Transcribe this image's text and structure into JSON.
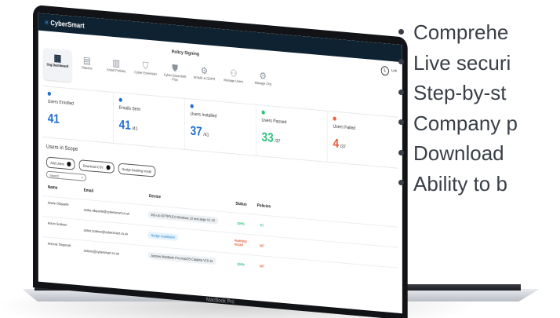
{
  "app": {
    "brand": "CyberSmart",
    "page_title": "Policy Signing",
    "user_label": "Lee",
    "user_initial": "L"
  },
  "nav": [
    {
      "label": "Org Dashboard",
      "icon": "grid-icon",
      "glyph": "▦"
    },
    {
      "label": "Reports",
      "icon": "document-icon",
      "glyph": "▤"
    },
    {
      "label": "Smart Policies",
      "icon": "policy-icon",
      "glyph": "▥"
    },
    {
      "label": "Cyber Essentials",
      "icon": "shield-icon",
      "glyph": "⛉"
    },
    {
      "label": "Cyber Essentials Plus",
      "icon": "shield-plus-icon",
      "glyph": "⛊"
    },
    {
      "label": "IASME & GDPR",
      "icon": "gear-icon",
      "glyph": "⚙"
    },
    {
      "label": "Manage Users",
      "icon": "users-icon",
      "glyph": "⚇"
    },
    {
      "label": "Manage Org",
      "icon": "org-gear-icon",
      "glyph": "⚙"
    }
  ],
  "stats": [
    {
      "label": "Users Enrolled",
      "value": "41",
      "of": "",
      "color": "#1f6fd1"
    },
    {
      "label": "Emails Sent",
      "value": "41",
      "of": "/41",
      "color": "#1f6fd1"
    },
    {
      "label": "Users Installed",
      "value": "37",
      "of": "/41",
      "color": "#1f6fd1"
    },
    {
      "label": "Users Passed",
      "value": "33",
      "of": "/37",
      "color": "#2fc27a"
    },
    {
      "label": "Users Failed",
      "value": "4",
      "of": "/37",
      "color": "#e8603c"
    }
  ],
  "scope": {
    "title": "Users in Scope",
    "buttons": [
      "Add Users",
      "Download CSV",
      "Nudge Awaiting Install"
    ],
    "search_placeholder": "Search",
    "columns": [
      "Name",
      "Email",
      "Device",
      "Status",
      "Policies"
    ],
    "rows": [
      {
        "name": "Andre Oliquarte",
        "email": "andre.oliquarte@cybersmart.co.uk",
        "device": "MS-LK-OPTIPLEX Windows 10 and apps V1.10",
        "status": "100%",
        "policies": "7/7",
        "status_type": "ok"
      },
      {
        "name": "Anton Scaleso",
        "email": "anton.scaleso@cybersmart.co.uk",
        "device": "Nudge Installation",
        "status": "Awaiting Install",
        "policies": "N/7",
        "status_type": "warn"
      },
      {
        "name": "Antonis Tsiopouls",
        "email": "antonis@cybersmart.co.uk",
        "device": "Antonis MacBook Pro macOS Catalina V10.15",
        "status": "100%",
        "policies": "N/7",
        "status_type": "ok"
      }
    ]
  },
  "laptop_label": "MacBook Pro",
  "bullets": [
    "Comprehe",
    "Live securi",
    "Step-by-st",
    "Company p",
    "Download",
    "Ability to b"
  ]
}
